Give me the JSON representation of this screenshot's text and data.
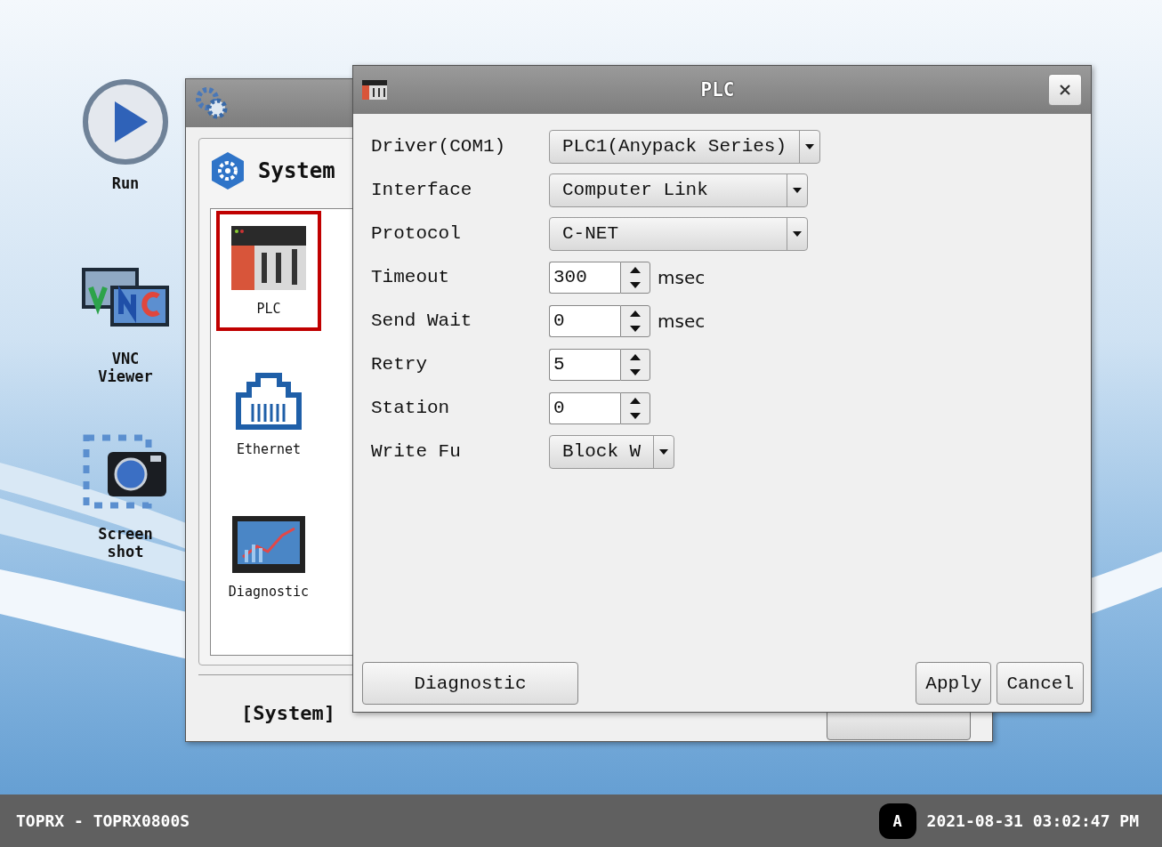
{
  "launcher": [
    {
      "kind": "run",
      "label": "Run"
    },
    {
      "kind": "vnc",
      "label": "VNC Viewer"
    },
    {
      "kind": "screenshot",
      "label": "Screen shot"
    }
  ],
  "system_window": {
    "heading": "System",
    "items": [
      {
        "kind": "plc",
        "label": "PLC",
        "selected": true
      },
      {
        "kind": "ethernet",
        "label": "Ethernet",
        "selected": false
      },
      {
        "kind": "diagnostic",
        "label": "Diagnostic",
        "selected": false
      }
    ],
    "footer": "[System]"
  },
  "dialog": {
    "title": "PLC",
    "fields": [
      {
        "kind": "dropdown",
        "label": "Driver(COM1)",
        "value": "PLC1(Anypack Series)"
      },
      {
        "kind": "dropdown",
        "label": "Interface",
        "value": "Computer Link"
      },
      {
        "kind": "dropdown",
        "label": "Protocol",
        "value": "C-NET"
      },
      {
        "kind": "spinner",
        "label": "Timeout",
        "value": "300",
        "unit": "msec"
      },
      {
        "kind": "spinner",
        "label": "Send Wait",
        "value": "0",
        "unit": "msec"
      },
      {
        "kind": "spinner",
        "label": "Retry",
        "value": "5"
      },
      {
        "kind": "spinner",
        "label": "Station",
        "value": "0"
      },
      {
        "kind": "short-dropdown",
        "label": "Write Fu",
        "value": "Block W"
      }
    ],
    "left_buttons": [
      "Diagnostic"
    ],
    "right_buttons": [
      "Apply",
      "Cancel"
    ]
  },
  "taskbar": {
    "device": "TOPRX - TOPRX0800S",
    "badge": "A",
    "datetime": "2021-08-31 03:02:47 PM"
  }
}
